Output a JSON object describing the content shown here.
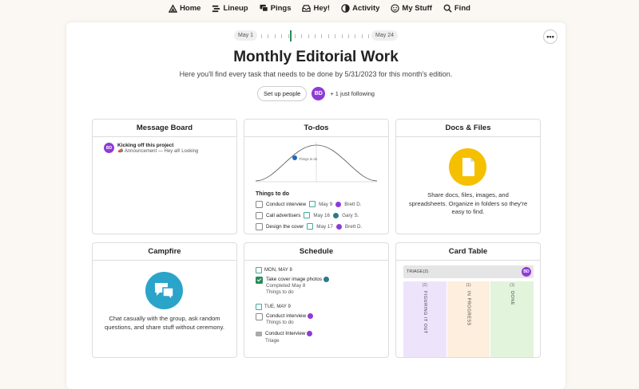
{
  "nav": [
    {
      "label": "Home",
      "icon": "home-icon"
    },
    {
      "label": "Lineup",
      "icon": "lineup-icon"
    },
    {
      "label": "Pings",
      "icon": "pings-icon"
    },
    {
      "label": "Hey!",
      "icon": "hey-icon"
    },
    {
      "label": "Activity",
      "icon": "activity-icon"
    },
    {
      "label": "My Stuff",
      "icon": "my-stuff-icon"
    },
    {
      "label": "Find",
      "icon": "search-icon"
    }
  ],
  "timeline": {
    "start": "May 1",
    "end": "May 24"
  },
  "project": {
    "title": "Monthly Editorial Work",
    "description": "Here you'll find every task that needs to be done by 5/31/2023 for this month's edition.",
    "setup_label": "Set up people",
    "avatar_initials": "BD",
    "following_text": "+ 1 just following"
  },
  "message_board": {
    "title": "Message Board",
    "item_title": "Kicking off this project",
    "item_avatar": "BD",
    "item_sub": "Announcement — Hey all! Looking"
  },
  "todos": {
    "title": "To-dos",
    "hill_label": "Things to do",
    "list_title": "Things to do",
    "items": [
      {
        "label": "Conduct interview",
        "date": "May 9",
        "person": "Brett D."
      },
      {
        "label": "Call advertisers",
        "date": "May 16",
        "person": "Gary S."
      },
      {
        "label": "Design the cover",
        "date": "May 17",
        "person": "Brett D."
      }
    ]
  },
  "docs": {
    "title": "Docs & Files",
    "description": "Share docs, files, images, and spreadsheets. Organize in folders so they're easy to find."
  },
  "campfire": {
    "title": "Campfire",
    "description": "Chat casually with the group, ask random questions, and share stuff without ceremony."
  },
  "schedule": {
    "title": "Schedule",
    "days": [
      {
        "label": "MON, MAY 8",
        "events": [
          {
            "title": "Take cover image photos",
            "lines": [
              "Completed May 8",
              "Things to do"
            ],
            "checked": true
          }
        ]
      },
      {
        "label": "TUE, MAY 9",
        "events": [
          {
            "title": "Conduct interview",
            "lines": [
              "Things to do"
            ],
            "checked": false
          },
          {
            "title": "Conduct Interview",
            "lines": [
              "Triage"
            ],
            "checked": false
          }
        ]
      }
    ]
  },
  "card_table": {
    "title": "Card Table",
    "triage_label": "TRIAGE",
    "triage_count": "(2)",
    "avatar": "BD",
    "columns": [
      {
        "label": "FIGURING IT OUT",
        "count": "(2)",
        "color": "#ede4fb"
      },
      {
        "label": "IN PROGRESS",
        "count": "(1)",
        "color": "#fdeedd"
      },
      {
        "label": "DONE",
        "count": "(1)",
        "color": "#e2f4dc"
      }
    ]
  },
  "colors": {
    "accent": "#8e3bd6",
    "teal": "#2a8a5a",
    "docs_yellow": "#f5c000",
    "campfire_blue": "#2aa4c9"
  }
}
